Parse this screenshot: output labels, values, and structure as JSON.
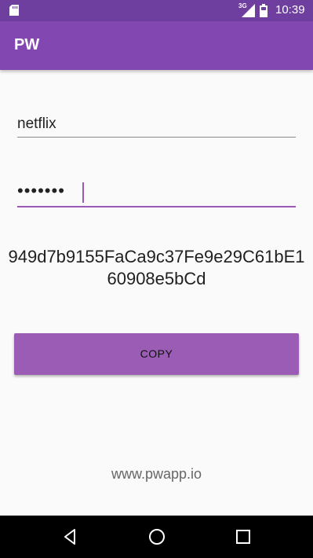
{
  "status_bar": {
    "network_label": "3G",
    "time": "10:39",
    "icons": [
      "sd-card-icon",
      "signal-icon",
      "battery-icon"
    ]
  },
  "app_bar": {
    "title": "PW",
    "color": "#8247b0"
  },
  "form": {
    "site_value": "netflix",
    "password_masked": "•••••••",
    "accent_color": "#9b59b6"
  },
  "output": {
    "hash": "949d7b9155FaCa9c37Fe9e29C61bE160908e5bCd"
  },
  "actions": {
    "copy_label": "COPY"
  },
  "footer": {
    "link": "www.pwapp.io"
  },
  "nav_bar": {
    "icons": [
      "back-icon",
      "home-icon",
      "recents-icon"
    ]
  }
}
